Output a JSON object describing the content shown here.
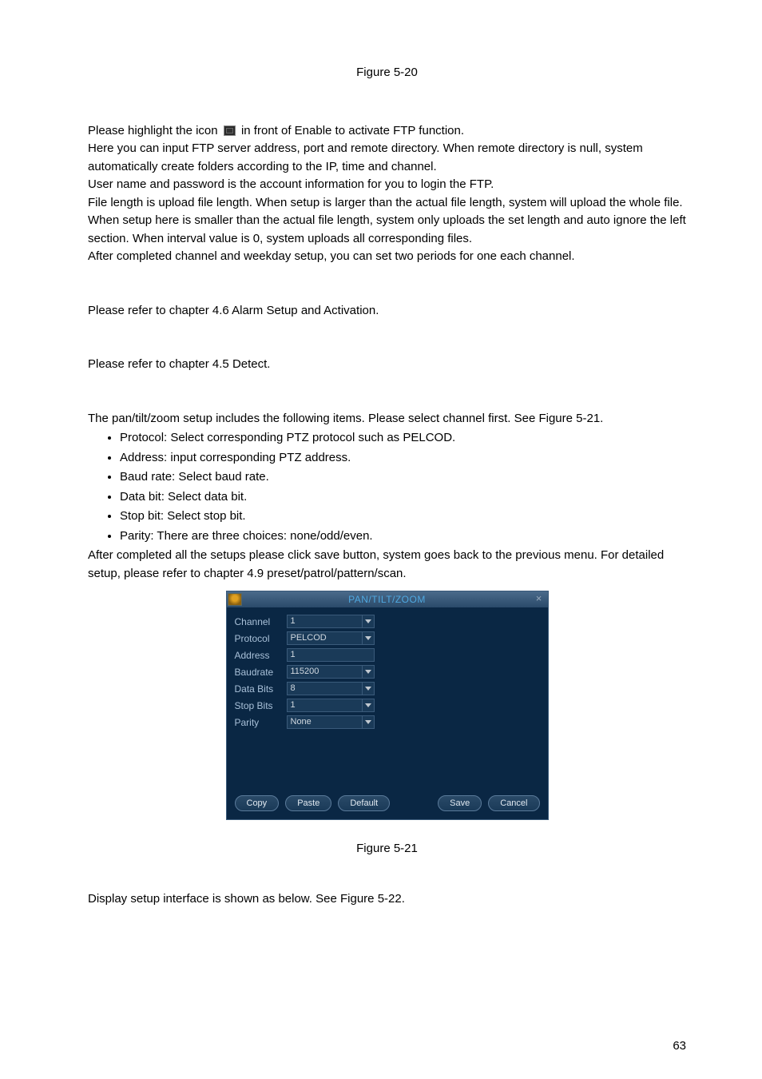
{
  "figure_top": "Figure 5-20",
  "p1": {
    "a": "Please highlight the icon",
    "b": "in front of Enable to activate FTP function."
  },
  "p2": "Here you can input FTP server address, port and remote directory. When remote directory is null, system automatically create folders according to the IP, time and channel.",
  "p3": "User name and password is the account information for you to login the FTP.",
  "p4": "File length is upload file length. When setup is larger than the actual file length, system will upload the whole file. When setup here is smaller than the actual file length, system only uploads the set length and auto ignore the left section. When interval value is 0, system uploads all corresponding files.",
  "p5": "After completed channel and weekday setup, you can set two periods for one each channel.",
  "p6": "Please refer to chapter 4.6 Alarm Setup and Activation.",
  "p7": "Please refer to chapter 4.5 Detect.",
  "p8": "The pan/tilt/zoom setup includes the following items. Please select channel first. See Figure 5-21.",
  "bullets": [
    "Protocol: Select corresponding PTZ protocol such as PELCOD.",
    "Address: input corresponding PTZ address.",
    "Baud rate: Select baud rate.",
    "Data bit: Select data bit.",
    "Stop bit: Select stop bit.",
    "Parity: There are three choices: none/odd/even."
  ],
  "p9": "After completed all the setups please click save button, system goes back to the previous menu. For detailed setup, please refer to chapter 4.9 preset/patrol/pattern/scan.",
  "dialog": {
    "title": "PAN/TILT/ZOOM",
    "rows": [
      {
        "label": "Channel",
        "value": "1",
        "type": "select"
      },
      {
        "label": "Protocol",
        "value": "PELCOD",
        "type": "select"
      },
      {
        "label": "Address",
        "value": "1",
        "type": "input"
      },
      {
        "label": "Baudrate",
        "value": "115200",
        "type": "select"
      },
      {
        "label": "Data Bits",
        "value": "8",
        "type": "select"
      },
      {
        "label": "Stop Bits",
        "value": "1",
        "type": "select"
      },
      {
        "label": "Parity",
        "value": "None",
        "type": "select"
      }
    ],
    "buttons": {
      "copy": "Copy",
      "paste": "Paste",
      "default": "Default",
      "save": "Save",
      "cancel": "Cancel"
    }
  },
  "figure_bottom": "Figure 5-21",
  "p10": "Display setup interface is shown as below. See Figure 5-22.",
  "page_num": "63"
}
